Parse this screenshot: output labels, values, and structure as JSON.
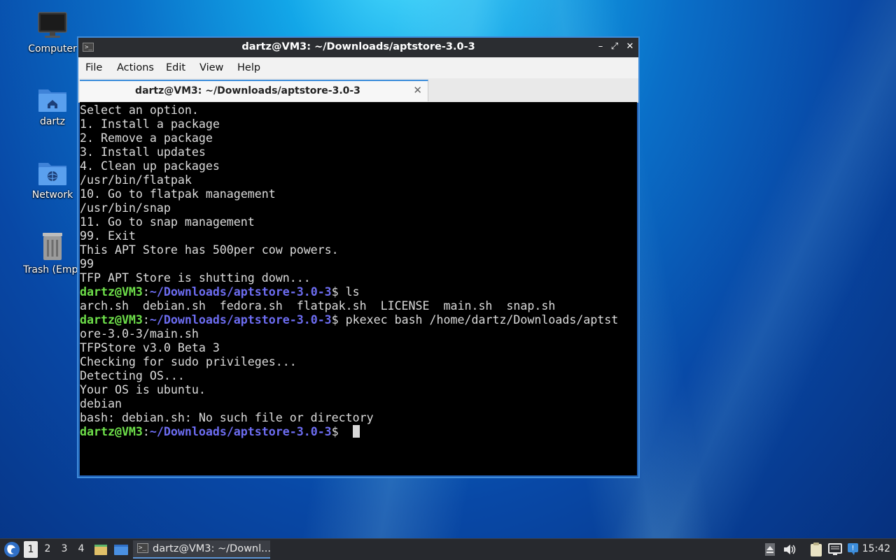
{
  "desktop": {
    "icons": [
      {
        "label": "Computer",
        "icon": "computer-icon"
      },
      {
        "label": "dartz",
        "icon": "home-folder-icon"
      },
      {
        "label": "Network",
        "icon": "network-folder-icon"
      },
      {
        "label": "Trash (Empt",
        "icon": "trash-icon"
      }
    ]
  },
  "window": {
    "title": "dartz@VM3: ~/Downloads/aptstore-3.0-3",
    "controls": {
      "minimize": "–",
      "maximize": "⤢",
      "close": "✕"
    },
    "menu": [
      "File",
      "Actions",
      "Edit",
      "View",
      "Help"
    ],
    "tab": {
      "title": "dartz@VM3: ~/Downloads/aptstore-3.0-3",
      "close": "✕"
    }
  },
  "terminal": {
    "lines": [
      "Select an option.",
      "1. Install a package",
      "2. Remove a package",
      "3. Install updates",
      "4. Clean up packages",
      "/usr/bin/flatpak",
      "10. Go to flatpak management",
      "/usr/bin/snap",
      "11. Go to snap management",
      "99. Exit",
      "This APT Store has 500per cow powers.",
      "99",
      "TFP APT Store is shutting down..."
    ],
    "prompt_user": "dartz@VM3",
    "prompt_sep": ":",
    "prompt_path": "~/Downloads/aptstore-3.0-3",
    "prompt_end": "$ ",
    "cmd1": "ls",
    "ls_output": "arch.sh  debian.sh  fedora.sh  flatpak.sh  LICENSE  main.sh  snap.sh",
    "cmd2": "pkexec bash /home/dartz/Downloads/aptst",
    "cmd2_wrap": "ore-3.0-3/main.sh",
    "output2": [
      "TFPStore v3.0 Beta 3",
      "Checking for sudo privileges...",
      "Detecting OS...",
      "Your OS is ubuntu.",
      "debian",
      "bash: debian.sh: No such file or directory"
    ]
  },
  "taskbar": {
    "workspaces": [
      "1",
      "2",
      "3",
      "4"
    ],
    "active_task": "dartz@VM3: ~/Downl...",
    "clock": "15:42"
  },
  "colors": {
    "prompt_user": "#6ee04a",
    "prompt_path": "#6d6df2",
    "accent": "#3c8ddb"
  }
}
